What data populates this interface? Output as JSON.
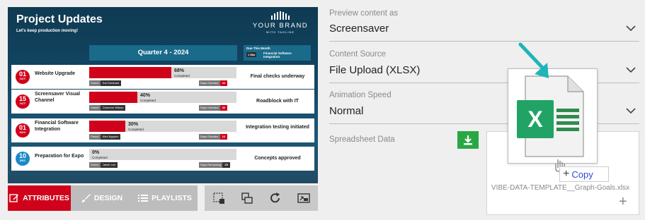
{
  "preview": {
    "title": "Project Updates",
    "subtitle": "Let's keep production moving!",
    "brand_name": "YOUR BRAND",
    "brand_tagline": "WITH TAGLINE",
    "quarter_label": "Quarter 4 - 2024",
    "due_this_month_label": "Due This Month",
    "due_this_month_item": "1 Mar",
    "due_this_month_text": "Financial Software Integration",
    "completed_label": "Completed",
    "owner_label": "Owner",
    "rows": [
      {
        "day": "01",
        "month": "OCT",
        "task": "Website Upgrade",
        "percent": "68%",
        "progress": 0.68,
        "bar_color": "#d0021b",
        "badge_color": "#d0021b",
        "owner": "Kai Gresham",
        "due_label": "Days Overdue",
        "due_value": "44",
        "due_color": "#d0021b",
        "status": "Final checks underway"
      },
      {
        "day": "15",
        "month": "OCT",
        "task": "Screensaver Visual Channel",
        "percent": "40%",
        "progress": 0.4,
        "bar_color": "#d0021b",
        "badge_color": "#d0021b",
        "owner": "Cameron Wilson",
        "due_label": "Days Overdue",
        "due_value": "30",
        "due_color": "#d0021b",
        "status": "Roadblock with IT"
      },
      {
        "day": "01",
        "month": "NOV",
        "task": "Financial Software Integration",
        "percent": "30%",
        "progress": 0.3,
        "bar_color": "#d0021b",
        "badge_color": "#d0021b",
        "owner": "Alex Nguyen",
        "due_label": "Days Overdue",
        "due_value": "13",
        "due_color": "#d0021b",
        "status": "Integration testing initiated"
      },
      {
        "day": "10",
        "month": "DEC",
        "task": "Preparation for Expo",
        "percent": "0%",
        "progress": 0.0,
        "bar_color": "#1a6a8a",
        "badge_color": "#1a8ac8",
        "owner": "Jamie Lee",
        "due_label": "Days Remaining",
        "due_value": "25",
        "due_color": "#333333",
        "status": "Concepts approved"
      }
    ]
  },
  "toolbar": {
    "attributes_label": "ATTRIBUTES",
    "design_label": "DESIGN",
    "playlists_label": "PLAYLISTS",
    "accent": "#d0021b"
  },
  "settings": {
    "preview_as_label": "Preview content as",
    "preview_as_value": "Screensaver",
    "content_source_label": "Content Source",
    "content_source_value": "File Upload (XLSX)",
    "animation_speed_label": "Animation Speed",
    "animation_speed_value": "Normal",
    "spreadsheet_label": "Spreadsheet Data",
    "file_name": "VIBE-DATA-TEMPLATE__Graph-Goals.xlsx",
    "copy_label": "Copy",
    "excel_letter": "X"
  }
}
